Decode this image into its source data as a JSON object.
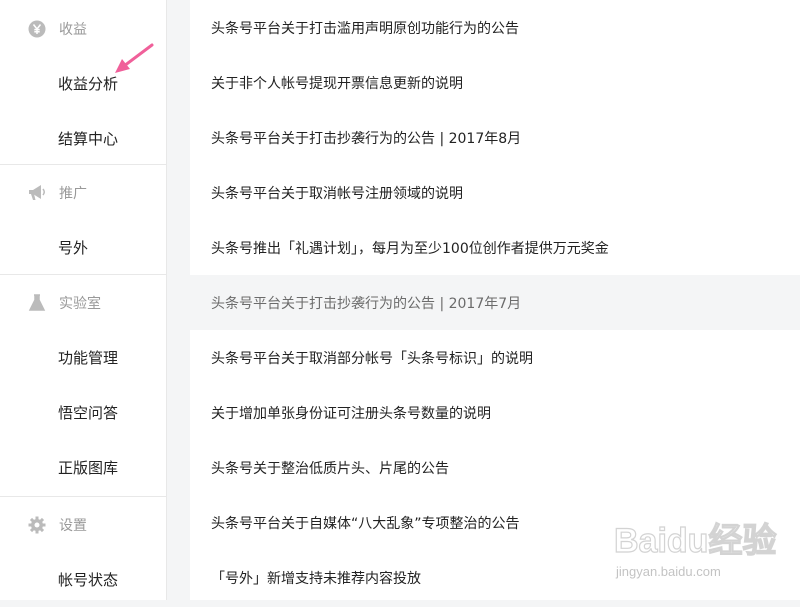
{
  "sidebar": {
    "income": {
      "header": "收益",
      "icon": "yen-coin-icon",
      "items": [
        "收益分析",
        "结算中心"
      ]
    },
    "promotion": {
      "header": "推广",
      "icon": "megaphone-icon",
      "items": [
        "号外"
      ]
    },
    "lab": {
      "header": "实验室",
      "icon": "flask-icon",
      "items": [
        "功能管理",
        "悟空问答",
        "正版图库"
      ]
    },
    "settings": {
      "header": "设置",
      "icon": "gear-icon",
      "items": [
        "帐号状态"
      ]
    }
  },
  "notices": [
    "头条号平台关于打击滥用声明原创功能行为的公告",
    "关于非个人帐号提现开票信息更新的说明",
    "头条号平台关于打击抄袭行为的公告 | 2017年8月",
    "头条号平台关于取消帐号注册领域的说明",
    "头条号推出「礼遇计划」，每月为至少100位创作者提供万元奖金",
    "头条号平台关于打击抄袭行为的公告 | 2017年7月",
    "头条号平台关于取消部分帐号「头条号标识」的说明",
    "关于增加单张身份证可注册头条号数量的说明",
    "头条号关于整治低质片头、片尾的公告",
    "头条号平台关于自媒体“八大乱象”专项整治的公告",
    "「号外」新增支持未推荐内容投放"
  ],
  "watermark": {
    "brand": "Baidu经验",
    "url": "jingyan.baidu.com"
  },
  "colors": {
    "icon": "#bbbbbb",
    "arrow": "#f0609a",
    "hover_bg": "#f4f5f6"
  }
}
